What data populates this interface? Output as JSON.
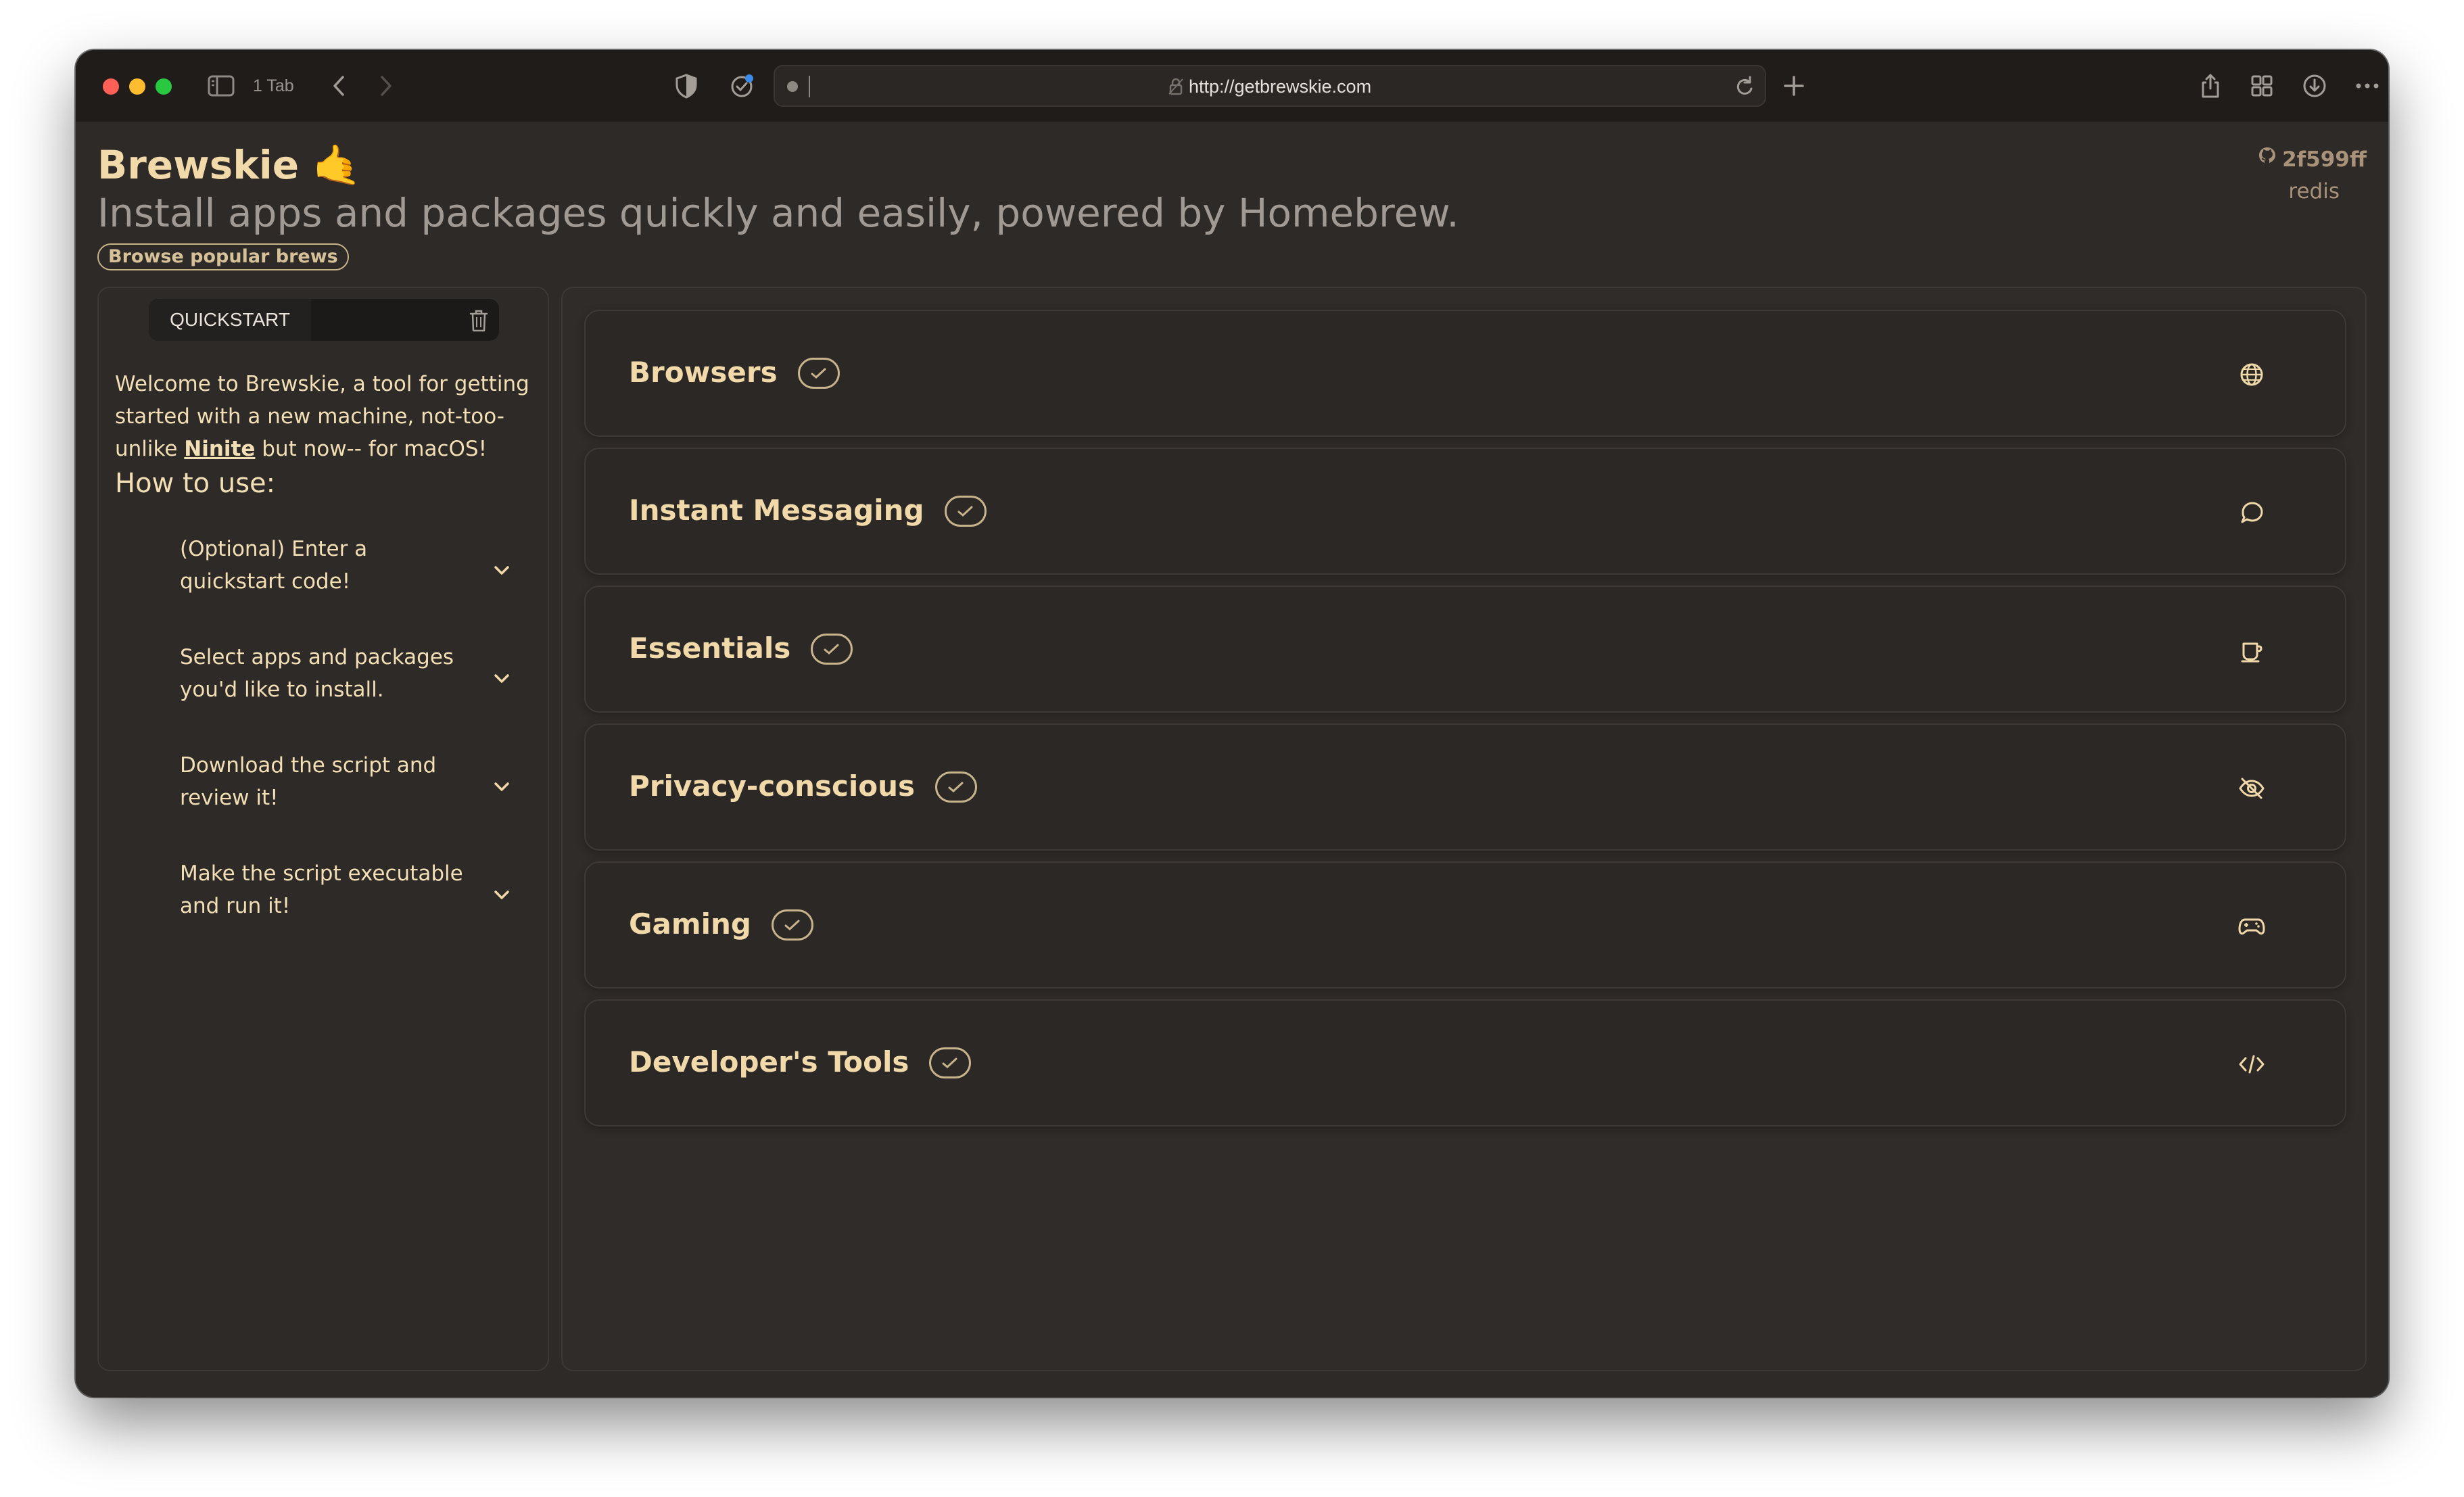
{
  "browser": {
    "tab_count": "1 Tab",
    "url": "http://getbrewskie.com"
  },
  "header": {
    "title": "Brewskie 🤙",
    "tagline": "Install apps and packages quickly and easily, powered by Homebrew.",
    "browse_label": "Browse popular brews",
    "commit": "2f599ff",
    "branch": "redis"
  },
  "sidebar": {
    "quickstart_label": "QUICKSTART",
    "welcome_prefix": "Welcome to Brewskie, a tool for getting started with a new machine, not-too-unlike ",
    "welcome_link": "Ninite",
    "welcome_suffix": " but now-- for macOS!",
    "howto_title": "How to use:",
    "steps": [
      {
        "label": "(Optional) Enter a quickstart code!"
      },
      {
        "label": "Select apps and packages you'd like to install."
      },
      {
        "label": "Download the script and review it!"
      },
      {
        "label": "Make the script executable and run it!"
      }
    ]
  },
  "categories": [
    {
      "name": "Browsers",
      "icon": "globe-icon"
    },
    {
      "name": "Instant Messaging",
      "icon": "chat-bubble-icon"
    },
    {
      "name": "Essentials",
      "icon": "coffee-cup-icon"
    },
    {
      "name": "Privacy-conscious",
      "icon": "eye-slash-icon"
    },
    {
      "name": "Gaming",
      "icon": "gamepad-icon"
    },
    {
      "name": "Developer's Tools",
      "icon": "code-icon"
    }
  ],
  "colors": {
    "accent": "#f1d9a9",
    "window_bg": "#2d2a27",
    "titlebar_bg": "#201c1a",
    "muted_text": "#a19a94"
  }
}
